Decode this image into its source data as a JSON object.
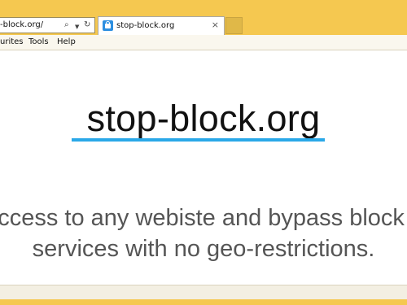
{
  "browser": {
    "address_value": "-block.org/",
    "search_icon": "magnifier-icon",
    "refresh_icon": "refresh-icon",
    "tab": {
      "label": "stop-block.org",
      "favicon": "lock-favicon-icon",
      "close": "×"
    },
    "menu": [
      "urites",
      "Tools",
      "Help"
    ]
  },
  "page": {
    "site_title": "stop-block.org",
    "tagline_line1": "access to any webiste and bypass block",
    "tagline_line2": "services with no geo-restrictions.",
    "accent_color": "#2aa8e8"
  }
}
